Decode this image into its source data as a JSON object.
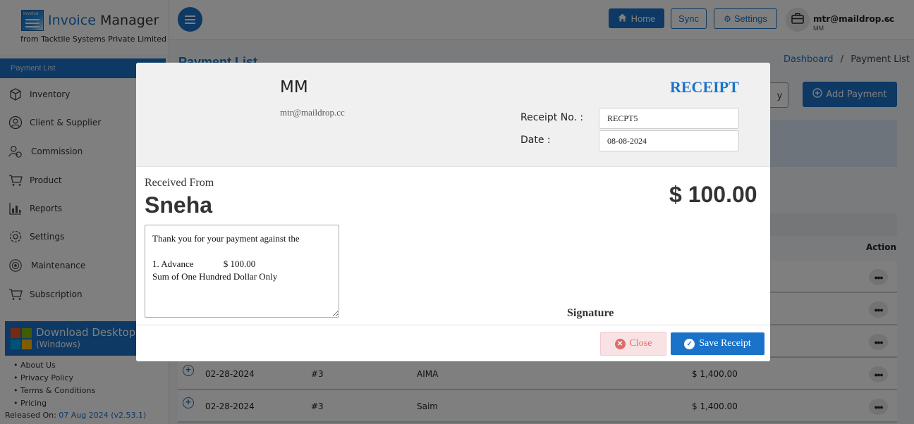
{
  "brand": {
    "logo_small": "Invoice",
    "title_part1": "Invoice",
    "title_part2": "Manager",
    "subtitle_prefix": "from",
    "subtitle_company": "Tacktile Systems Private Limited"
  },
  "sidebar": {
    "active_label": "Payment List",
    "items": [
      {
        "label": "Inventory",
        "icon": "box-icon"
      },
      {
        "label": "Client & Supplier",
        "icon": "user-icon"
      },
      {
        "label": "Commission",
        "icon": "commission-icon"
      },
      {
        "label": "Product",
        "icon": "cart-icon"
      },
      {
        "label": "Reports",
        "icon": "reports-icon"
      },
      {
        "label": "Settings",
        "icon": "gear-icon"
      },
      {
        "label": "Maintenance",
        "icon": "maintenance-icon"
      },
      {
        "label": "Subscription",
        "icon": "cart-icon"
      }
    ],
    "download_title": "Download Desktop A",
    "download_sub": "(Windows)",
    "links": [
      "About Us",
      "Privacy Policy",
      "Terms & Conditions",
      "Pricing"
    ],
    "released_label": "Released On:",
    "released_value": "07 Aug 2024 (v2.53.1)"
  },
  "topbar": {
    "home_label": "Home",
    "sync_label": "Sync",
    "settings_label": "Settings",
    "user_email": "mtr@maildrop.cc",
    "user_name": "MM"
  },
  "page": {
    "title": "Payment List",
    "breadcrumb_home": "Dashboard",
    "breadcrumb_sep": "/",
    "breadcrumb_current": "Payment List",
    "partial_button": "y",
    "add_payment_label": "Add Payment",
    "action_header": "Action",
    "rows": [
      {
        "date": "02-28-2024",
        "number": "#3",
        "name": "AIMA",
        "amount": "$ 1,400.00"
      },
      {
        "date": "02-28-2024",
        "number": "#3",
        "name": "Saim",
        "amount": "$ 1,400.00"
      }
    ],
    "row_plus": "+",
    "row_dots": "•••"
  },
  "modal": {
    "company_name": "MM",
    "company_email": "mtr@maildrop.cc",
    "receipt_title": "RECEIPT",
    "receipt_no_label": "Receipt No. :",
    "receipt_no_value": "RECPT5",
    "date_label": "Date :",
    "date_value": "08-08-2024",
    "received_from_label": "Received From",
    "payer_name": "Sneha",
    "amount": "$ 100.00",
    "note": "Thank you for your payment against the\n\n1. Advance             $ 100.00\nSum of One Hundred Dollar Only",
    "signature_label": "Signature",
    "close_label": "Close",
    "save_label": "Save Receipt"
  },
  "colors": {
    "accent": "#1a73c8",
    "danger": "#d9534f",
    "overlay": "rgba(0,0,0,0.5)"
  }
}
